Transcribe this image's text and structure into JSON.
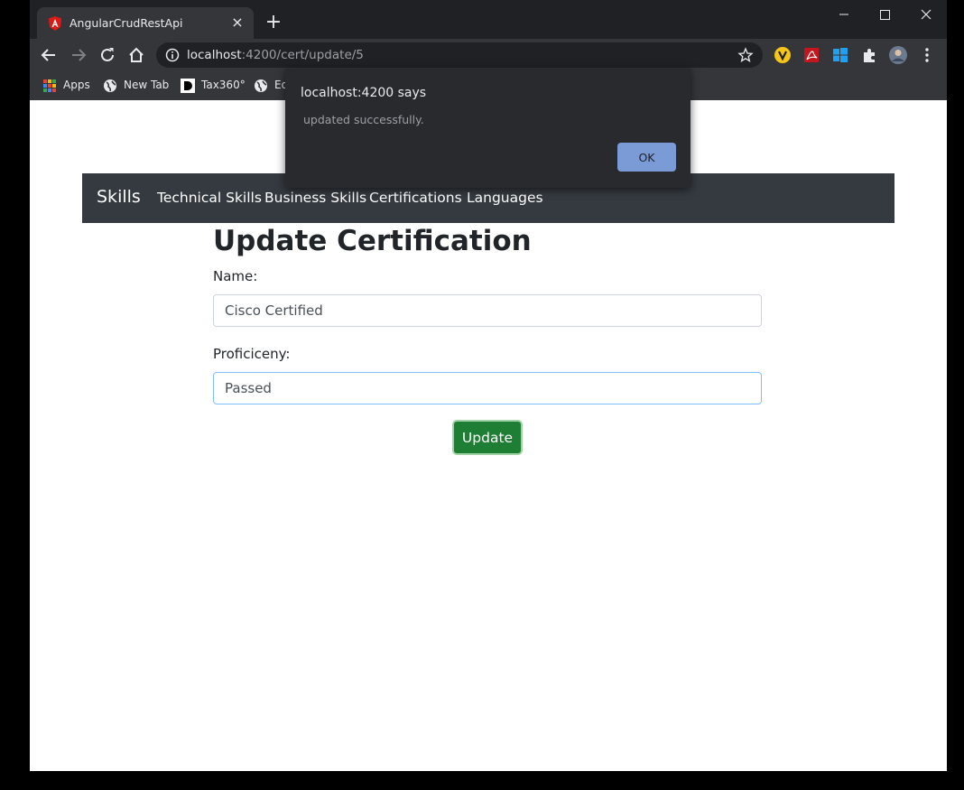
{
  "browser": {
    "tab_title": "AngularCrudRestApi",
    "tab_close": "×",
    "new_tab": "+",
    "url_host": "localhost",
    "url_path": ":4200/cert/update/5",
    "bookmarks": [
      {
        "label": "Apps",
        "icon": "apps-grid-icon"
      },
      {
        "label": "New Tab",
        "icon": "globe-icon"
      },
      {
        "label": "Tax360°",
        "icon": "d-logo-icon"
      },
      {
        "label": "Ed",
        "icon": "globe-icon"
      }
    ]
  },
  "navbar": {
    "brand": "Skills",
    "links": [
      "Technical Skills",
      "Business Skills",
      "Certifications",
      "Languages"
    ]
  },
  "form": {
    "title": "Update Certification",
    "name_label": "Name:",
    "name_value": "Cisco Certified",
    "proficiency_label": "Proficiceny:",
    "proficiency_value": "Passed",
    "submit_label": "Update"
  },
  "dialog": {
    "title": "localhost:4200 says",
    "message": "updated successfully.",
    "ok_label": "OK"
  },
  "colors": {
    "navbar_bg": "#343a40",
    "button_bg": "#1e7e34",
    "dialog_bg": "#292a2d",
    "ok_bg": "#7b9bd6"
  }
}
